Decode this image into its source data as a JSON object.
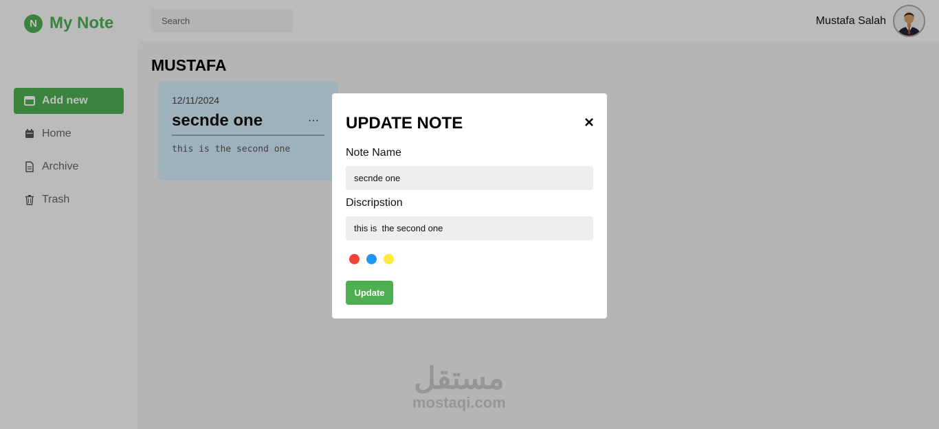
{
  "brand": {
    "logo_letter": "N",
    "name": "My Note"
  },
  "search": {
    "placeholder": "Search"
  },
  "user": {
    "name": "Mustafa Salah"
  },
  "sidebar": {
    "items": [
      {
        "label": "Add new",
        "icon": "window-icon"
      },
      {
        "label": "Home",
        "icon": "calendar-icon"
      },
      {
        "label": "Archive",
        "icon": "file-icon"
      },
      {
        "label": "Trash",
        "icon": "trash-icon"
      }
    ]
  },
  "main": {
    "section_title": "MUSTAFA",
    "notes": [
      {
        "date": "12/11/2024",
        "title": "secnde one",
        "menu": "···",
        "body": "this is the second one"
      }
    ]
  },
  "watermark": {
    "arabic": "مستقل",
    "latin": "mostaqi.com"
  },
  "modal": {
    "title": "UPDATE NOTE",
    "name_label": "Note Name",
    "name_value": "secnde one",
    "desc_label": "Discripstion",
    "desc_value": "this is  the second one",
    "colors": [
      "#f44336",
      "#2196f3",
      "#ffeb3b"
    ],
    "update_label": "Update"
  },
  "colors": {
    "accent": "#4caf50",
    "note_bg": "#d5ecf9",
    "overlay": "rgba(0,0,0,0.25)"
  }
}
